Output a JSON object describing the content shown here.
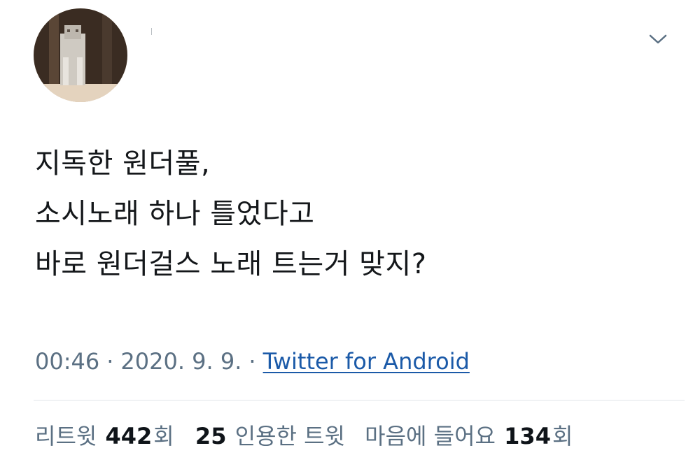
{
  "tweet": {
    "lines": [
      "지독한 원더풀,",
      "소시노래 하나 틀었다고",
      "바로 원더걸스 노래 트는거 맞지?"
    ]
  },
  "meta": {
    "time": "00:46",
    "separator": "·",
    "date": "2020. 9. 9.",
    "source": "Twitter for Android"
  },
  "stats": {
    "retweets": {
      "prefix": "리트윗",
      "count": "442",
      "suffix": "회"
    },
    "quotes": {
      "count": "25",
      "suffix": "인용한 트윗"
    },
    "likes": {
      "prefix": "마음에 들어요",
      "count": "134",
      "suffix": "회"
    }
  },
  "icons": {
    "more": "chevron-down-icon"
  },
  "colors": {
    "text": "#0f1419",
    "secondary": "#5b7083",
    "link": "#1b5aa8",
    "divider": "#e1e6ea"
  }
}
